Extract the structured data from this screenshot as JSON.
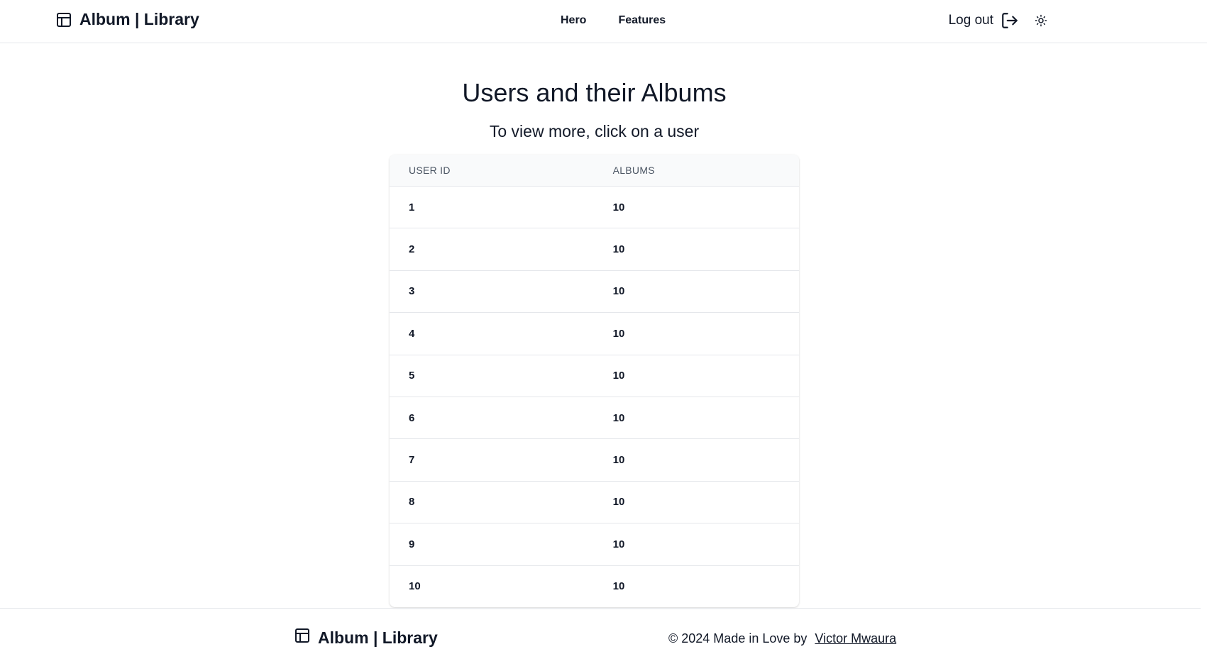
{
  "header": {
    "brand": "Album | Library",
    "brand_icon": "layout-icon",
    "nav": [
      {
        "label": "Hero"
      },
      {
        "label": "Features"
      }
    ],
    "logout_label": "Log out",
    "logout_icon": "logout-icon",
    "theme_icon": "sun-icon"
  },
  "main": {
    "title": "Users and their Albums",
    "subtitle": "To view more, click on a user",
    "table": {
      "columns": [
        "USER ID",
        "ALBUMS"
      ],
      "rows": [
        {
          "user_id": "1",
          "albums": "10"
        },
        {
          "user_id": "2",
          "albums": "10"
        },
        {
          "user_id": "3",
          "albums": "10"
        },
        {
          "user_id": "4",
          "albums": "10"
        },
        {
          "user_id": "5",
          "albums": "10"
        },
        {
          "user_id": "6",
          "albums": "10"
        },
        {
          "user_id": "7",
          "albums": "10"
        },
        {
          "user_id": "8",
          "albums": "10"
        },
        {
          "user_id": "9",
          "albums": "10"
        },
        {
          "user_id": "10",
          "albums": "10"
        }
      ]
    }
  },
  "footer": {
    "brand": "Album | Library",
    "credit_text": "© 2024 Made in Love by",
    "author_link": "Victor Mwaura"
  },
  "colors": {
    "text": "#111827",
    "muted": "#4b5563",
    "border": "#e5e7eb",
    "table_header_bg": "#f9fafb"
  }
}
